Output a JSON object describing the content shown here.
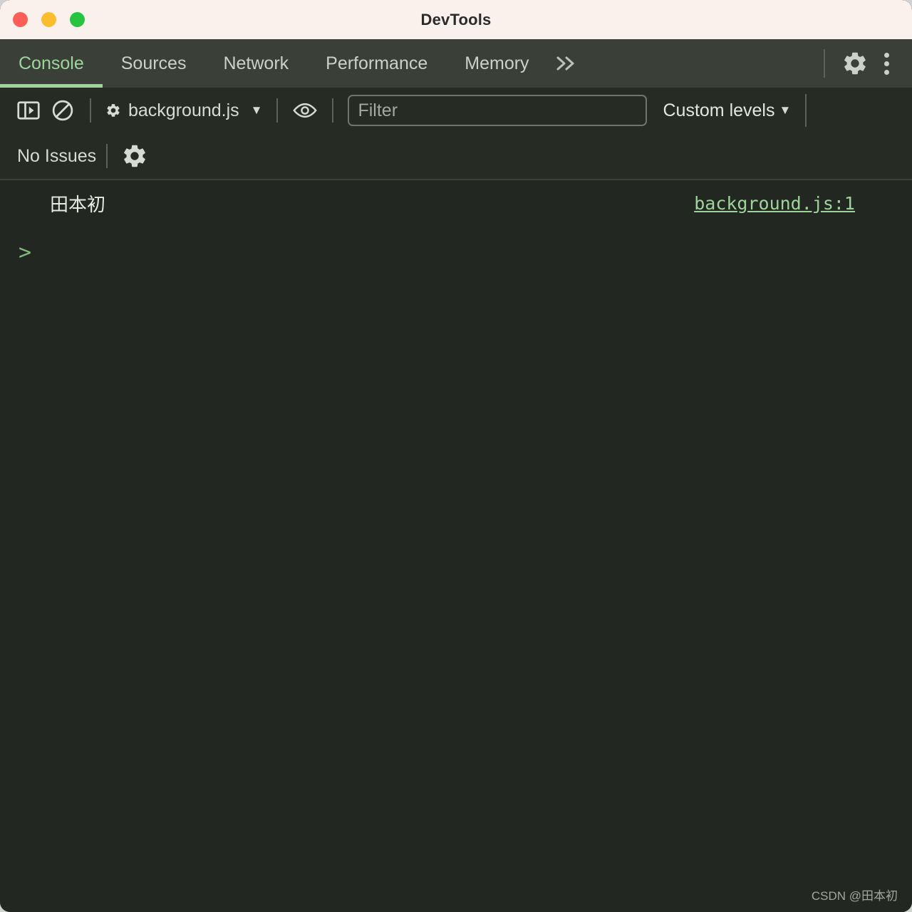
{
  "window": {
    "title": "DevTools",
    "traffic_lights": [
      {
        "name": "close",
        "color": "#fb5d57"
      },
      {
        "name": "minimize",
        "color": "#fbbd2e"
      },
      {
        "name": "maximize",
        "color": "#27c53f"
      }
    ]
  },
  "tabbar": {
    "tabs": [
      {
        "label": "Console",
        "active": true
      },
      {
        "label": "Sources",
        "active": false
      },
      {
        "label": "Network",
        "active": false
      },
      {
        "label": "Performance",
        "active": false
      },
      {
        "label": "Memory",
        "active": false
      }
    ],
    "overflow_label": "»",
    "settings_icon": "gear-icon",
    "menu_icon": "kebab-menu-icon",
    "active_color": "#9ed49c"
  },
  "toolbar": {
    "sidebar_icon": "show-console-sidebar-icon",
    "clear_icon": "clear-console-icon",
    "context": {
      "icon": "cog-icon",
      "label": "background.js",
      "caret": "▼"
    },
    "eye_icon": "live-expression-eye-icon",
    "filter": {
      "value": "",
      "placeholder": "Filter"
    },
    "levels": {
      "label": "Custom levels",
      "caret": "▼"
    }
  },
  "toolbar2": {
    "issues_label": "No Issues",
    "settings_icon": "console-settings-gear-icon"
  },
  "console": {
    "messages": [
      {
        "text": "田本初",
        "source": "background.js:1"
      }
    ],
    "prompt": ">"
  },
  "watermark": {
    "text": "CSDN @田本初"
  }
}
